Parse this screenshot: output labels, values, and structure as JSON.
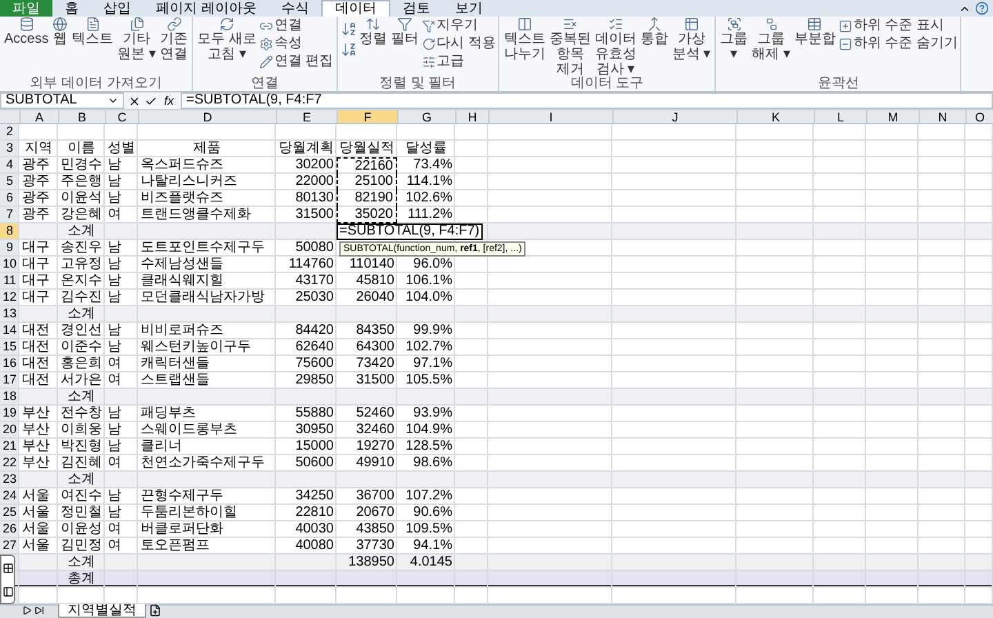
{
  "ribbon_tabs": [
    {
      "label": "파일",
      "kind": "file",
      "selected": false
    },
    {
      "label": "홈",
      "kind": "tab",
      "selected": false
    },
    {
      "label": "삽입",
      "kind": "tab",
      "selected": false
    },
    {
      "label": "페이지 레이아웃",
      "kind": "tab",
      "selected": false
    },
    {
      "label": "수식",
      "kind": "tab",
      "selected": false
    },
    {
      "label": "데이터",
      "kind": "tab",
      "selected": true
    },
    {
      "label": "검토",
      "kind": "tab",
      "selected": false
    },
    {
      "label": "보기",
      "kind": "tab",
      "selected": false
    }
  ],
  "ribbon_groups": [
    {
      "label": "외부 데이터 가져오기",
      "items": [
        {
          "kind": "large",
          "lines": [
            "Access"
          ]
        },
        {
          "kind": "large",
          "lines": [
            "웹"
          ]
        },
        {
          "kind": "large",
          "lines": [
            "텍스트"
          ]
        },
        {
          "kind": "large",
          "lines": [
            "기타",
            "원본 ▾"
          ]
        },
        {
          "kind": "large",
          "lines": [
            "기존",
            "연결"
          ]
        }
      ]
    },
    {
      "label": "연결",
      "items": [
        {
          "kind": "large",
          "lines": [
            "모두 새로",
            "고침 ▾"
          ]
        },
        {
          "kind": "stack",
          "items": [
            "연결",
            "속성",
            "연결 편집"
          ]
        }
      ]
    },
    {
      "label": "정렬 및 필터",
      "items": [
        {
          "kind": "sort_icons"
        },
        {
          "kind": "large",
          "lines": [
            "정렬"
          ]
        },
        {
          "kind": "large",
          "lines": [
            "필터"
          ]
        },
        {
          "kind": "stack",
          "items": [
            "지우기",
            "다시 적용",
            "고급"
          ]
        }
      ]
    },
    {
      "label": "데이터 도구",
      "items": [
        {
          "kind": "large",
          "lines": [
            "텍스트",
            "나누기"
          ]
        },
        {
          "kind": "large",
          "lines": [
            "중복된",
            "항목",
            "제거"
          ]
        },
        {
          "kind": "large",
          "lines": [
            "데이터",
            "유효성",
            "검사 ▾"
          ]
        },
        {
          "kind": "large",
          "lines": [
            "통합"
          ]
        },
        {
          "kind": "large",
          "lines": [
            "가상",
            "분석 ▾"
          ]
        }
      ]
    },
    {
      "label": "윤곽선",
      "items": [
        {
          "kind": "large",
          "lines": [
            "그룹",
            "▾"
          ]
        },
        {
          "kind": "large",
          "lines": [
            "그룹",
            "해제 ▾"
          ]
        },
        {
          "kind": "large",
          "lines": [
            "부분합"
          ]
        },
        {
          "kind": "stack",
          "items": [
            "하위 수준 표시",
            "하위 수준 숨기기"
          ]
        }
      ]
    }
  ],
  "formula_bar": {
    "name_box": "SUBTOTAL",
    "function_button": "fx",
    "formula": "=SUBTOTAL(9, F4:F7"
  },
  "columns": [
    {
      "label": "A",
      "selected": false
    },
    {
      "label": "B",
      "selected": false
    },
    {
      "label": "C",
      "selected": false
    },
    {
      "label": "D",
      "selected": false
    },
    {
      "label": "E",
      "selected": false
    },
    {
      "label": "F",
      "selected": true
    },
    {
      "label": "G",
      "selected": false
    },
    {
      "label": "H",
      "selected": false
    },
    {
      "label": "I",
      "selected": false
    },
    {
      "label": "J",
      "selected": false
    },
    {
      "label": "K",
      "selected": false
    },
    {
      "label": "L",
      "selected": false
    },
    {
      "label": "M",
      "selected": false
    },
    {
      "label": "N",
      "selected": false
    },
    {
      "label": "O",
      "selected": false
    }
  ],
  "rows": [
    {
      "row": "2",
      "kind": "blank",
      "selected": false,
      "in_marquee": false,
      "cells": {}
    },
    {
      "row": "3",
      "kind": "header",
      "selected": false,
      "in_marquee": false,
      "cells": {
        "A": "지역",
        "B": "이름",
        "C": "성별",
        "D": "제품",
        "E": "당월계획",
        "F": "당월실적",
        "G": "달성률"
      }
    },
    {
      "row": "4",
      "kind": "data",
      "selected": false,
      "in_marquee": true,
      "cells": {
        "A": "광주",
        "B": "민경수",
        "C": "남",
        "D": "옥스퍼드슈즈",
        "E": "30200",
        "F": "22160",
        "G": "73.4%"
      }
    },
    {
      "row": "5",
      "kind": "data",
      "selected": false,
      "in_marquee": true,
      "cells": {
        "A": "광주",
        "B": "주은행",
        "C": "남",
        "D": "나탈리스니커즈",
        "E": "22000",
        "F": "25100",
        "G": "114.1%"
      }
    },
    {
      "row": "6",
      "kind": "data",
      "selected": false,
      "in_marquee": true,
      "cells": {
        "A": "광주",
        "B": "이윤석",
        "C": "남",
        "D": "비즈플랫슈즈",
        "E": "80130",
        "F": "82190",
        "G": "102.6%"
      }
    },
    {
      "row": "7",
      "kind": "data",
      "selected": false,
      "in_marquee": true,
      "cells": {
        "A": "광주",
        "B": "강은혜",
        "C": "여",
        "D": "트랜드앵클수제화",
        "E": "31500",
        "F": "35020",
        "G": "111.2%"
      }
    },
    {
      "row": "8",
      "kind": "subtotal",
      "selected": true,
      "in_marquee": false,
      "cells": {
        "B": "소계"
      },
      "editor": "=SUBTOTAL(9, F4:F7)",
      "tooltip": "SUBTOTAL(function_num, **ref1**, [ref2], ...)"
    },
    {
      "row": "9",
      "kind": "data",
      "selected": false,
      "in_marquee": false,
      "cells": {
        "A": "대구",
        "B": "송진우",
        "C": "남",
        "D": "도트포인트수제구두",
        "E": "50080"
      }
    },
    {
      "row": "10",
      "kind": "data",
      "selected": false,
      "in_marquee": false,
      "cells": {
        "A": "대구",
        "B": "고유정",
        "C": "남",
        "D": "수제남성샌들",
        "E": "114760",
        "F": "110140",
        "G": "96.0%"
      }
    },
    {
      "row": "11",
      "kind": "data",
      "selected": false,
      "in_marquee": false,
      "cells": {
        "A": "대구",
        "B": "온지수",
        "C": "남",
        "D": "클래식웨지힐",
        "E": "43170",
        "F": "45810",
        "G": "106.1%"
      }
    },
    {
      "row": "12",
      "kind": "data",
      "selected": false,
      "in_marquee": false,
      "cells": {
        "A": "대구",
        "B": "김수진",
        "C": "남",
        "D": "모던클래식남자가방",
        "E": "25030",
        "F": "26040",
        "G": "104.0%"
      }
    },
    {
      "row": "13",
      "kind": "subtotal",
      "selected": false,
      "in_marquee": false,
      "cells": {
        "B": "소계"
      }
    },
    {
      "row": "14",
      "kind": "data",
      "selected": false,
      "in_marquee": false,
      "cells": {
        "A": "대전",
        "B": "경인선",
        "C": "남",
        "D": "비비로퍼슈즈",
        "E": "84420",
        "F": "84350",
        "G": "99.9%"
      }
    },
    {
      "row": "15",
      "kind": "data",
      "selected": false,
      "in_marquee": false,
      "cells": {
        "A": "대전",
        "B": "이준수",
        "C": "남",
        "D": "웨스턴키높이구두",
        "E": "62640",
        "F": "64300",
        "G": "102.7%"
      }
    },
    {
      "row": "16",
      "kind": "data",
      "selected": false,
      "in_marquee": false,
      "cells": {
        "A": "대전",
        "B": "홍은희",
        "C": "여",
        "D": "캐릭터샌들",
        "E": "75600",
        "F": "73420",
        "G": "97.1%"
      }
    },
    {
      "row": "17",
      "kind": "data",
      "selected": false,
      "in_marquee": false,
      "cells": {
        "A": "대전",
        "B": "서가은",
        "C": "여",
        "D": "스트랩샌들",
        "E": "29850",
        "F": "31500",
        "G": "105.5%"
      }
    },
    {
      "row": "18",
      "kind": "subtotal",
      "selected": false,
      "in_marquee": false,
      "cells": {
        "B": "소계"
      }
    },
    {
      "row": "19",
      "kind": "data",
      "selected": false,
      "in_marquee": false,
      "cells": {
        "A": "부산",
        "B": "전수창",
        "C": "남",
        "D": "패딩부츠",
        "E": "55880",
        "F": "52460",
        "G": "93.9%"
      }
    },
    {
      "row": "20",
      "kind": "data",
      "selected": false,
      "in_marquee": false,
      "cells": {
        "A": "부산",
        "B": "이희웅",
        "C": "남",
        "D": "스웨이드롱부츠",
        "E": "30950",
        "F": "32460",
        "G": "104.9%"
      }
    },
    {
      "row": "21",
      "kind": "data",
      "selected": false,
      "in_marquee": false,
      "cells": {
        "A": "부산",
        "B": "박진형",
        "C": "남",
        "D": "클리너",
        "E": "15000",
        "F": "19270",
        "G": "128.5%"
      }
    },
    {
      "row": "22",
      "kind": "data",
      "selected": false,
      "in_marquee": false,
      "cells": {
        "A": "부산",
        "B": "김진혜",
        "C": "여",
        "D": "천연소가죽수제구두",
        "E": "50600",
        "F": "49910",
        "G": "98.6%"
      }
    },
    {
      "row": "23",
      "kind": "subtotal",
      "selected": false,
      "in_marquee": false,
      "cells": {
        "B": "소계"
      }
    },
    {
      "row": "24",
      "kind": "data",
      "selected": false,
      "in_marquee": false,
      "cells": {
        "A": "서울",
        "B": "여진수",
        "C": "남",
        "D": "끈형수제구두",
        "E": "34250",
        "F": "36700",
        "G": "107.2%"
      }
    },
    {
      "row": "25",
      "kind": "data",
      "selected": false,
      "in_marquee": false,
      "cells": {
        "A": "서울",
        "B": "정민철",
        "C": "남",
        "D": "두툼리본하이힐",
        "E": "22810",
        "F": "20670",
        "G": "90.6%"
      }
    },
    {
      "row": "26",
      "kind": "data",
      "selected": false,
      "in_marquee": false,
      "cells": {
        "A": "서울",
        "B": "이윤성",
        "C": "여",
        "D": "버클로퍼단화",
        "E": "40030",
        "F": "43850",
        "G": "109.5%"
      }
    },
    {
      "row": "27",
      "kind": "data",
      "selected": false,
      "in_marquee": false,
      "cells": {
        "A": "서울",
        "B": "김민정",
        "C": "여",
        "D": "토오픈펌프",
        "E": "40080",
        "F": "37730",
        "G": "94.1%"
      }
    },
    {
      "kind": "subtotal",
      "selected": false,
      "in_marquee": false,
      "cells": {
        "B": "소계",
        "F": "138950",
        "G": "4.0145"
      }
    },
    {
      "kind": "grand_total",
      "selected": false,
      "in_marquee": false,
      "cells": {
        "B": "총계"
      }
    },
    {
      "kind": "blank",
      "selected": false,
      "in_marquee": false,
      "cells": {}
    }
  ],
  "sheet_tabs": [
    {
      "label": "지역별실적",
      "selected": true
    }
  ]
}
